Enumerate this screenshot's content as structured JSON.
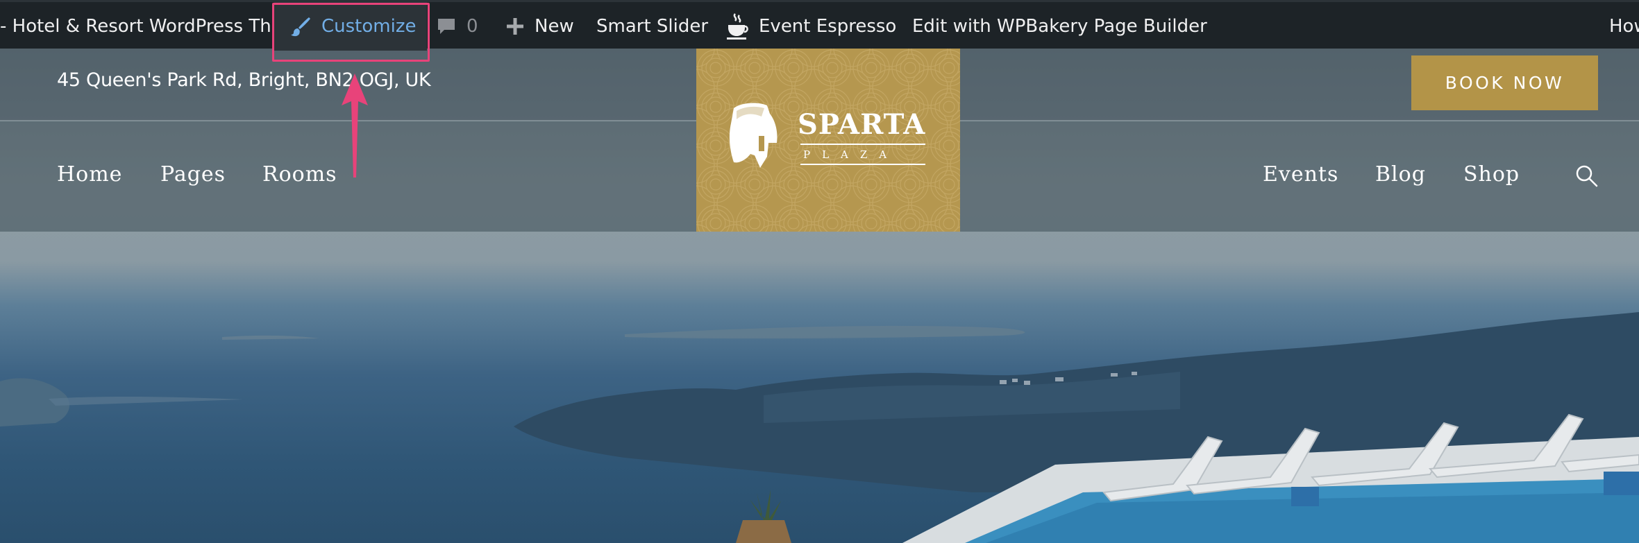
{
  "adminbar": {
    "site_title": "- Hotel & Resort WordPress Th...",
    "customize_label": "Customize",
    "comments_count": "0",
    "new_label": "New",
    "smart_slider_label": "Smart Slider",
    "event_espresso_label": "Event Espresso",
    "wpbakery_label": "Edit with WPBakery Page Builder",
    "howdy_label": "How",
    "icons": {
      "customize": "paintbrush-icon",
      "comments": "comment-bubble-icon",
      "new": "plus-icon",
      "event_espresso": "coffee-cup-icon"
    },
    "colors": {
      "background": "#1d2327",
      "text": "#f0f0f1",
      "active_link": "#72aee6",
      "highlight_box": "#e8437a"
    }
  },
  "header": {
    "address": "45 Queen's Park Rd, Bright, BN2 OGJ, UK",
    "book_button": "BOOK NOW",
    "book_button_color": "#b39448",
    "nav_left": [
      "Home",
      "Pages",
      "Rooms"
    ],
    "nav_right": [
      "Events",
      "Blog",
      "Shop"
    ],
    "search_icon": "magnifier-icon"
  },
  "logo": {
    "title": "SPARTA",
    "subtitle": "PLAZA",
    "icon": "spartan-helmet-icon",
    "background": "#b5974f"
  },
  "annotation": {
    "icon": "pointer-arrow-icon",
    "color": "#e8437a"
  }
}
